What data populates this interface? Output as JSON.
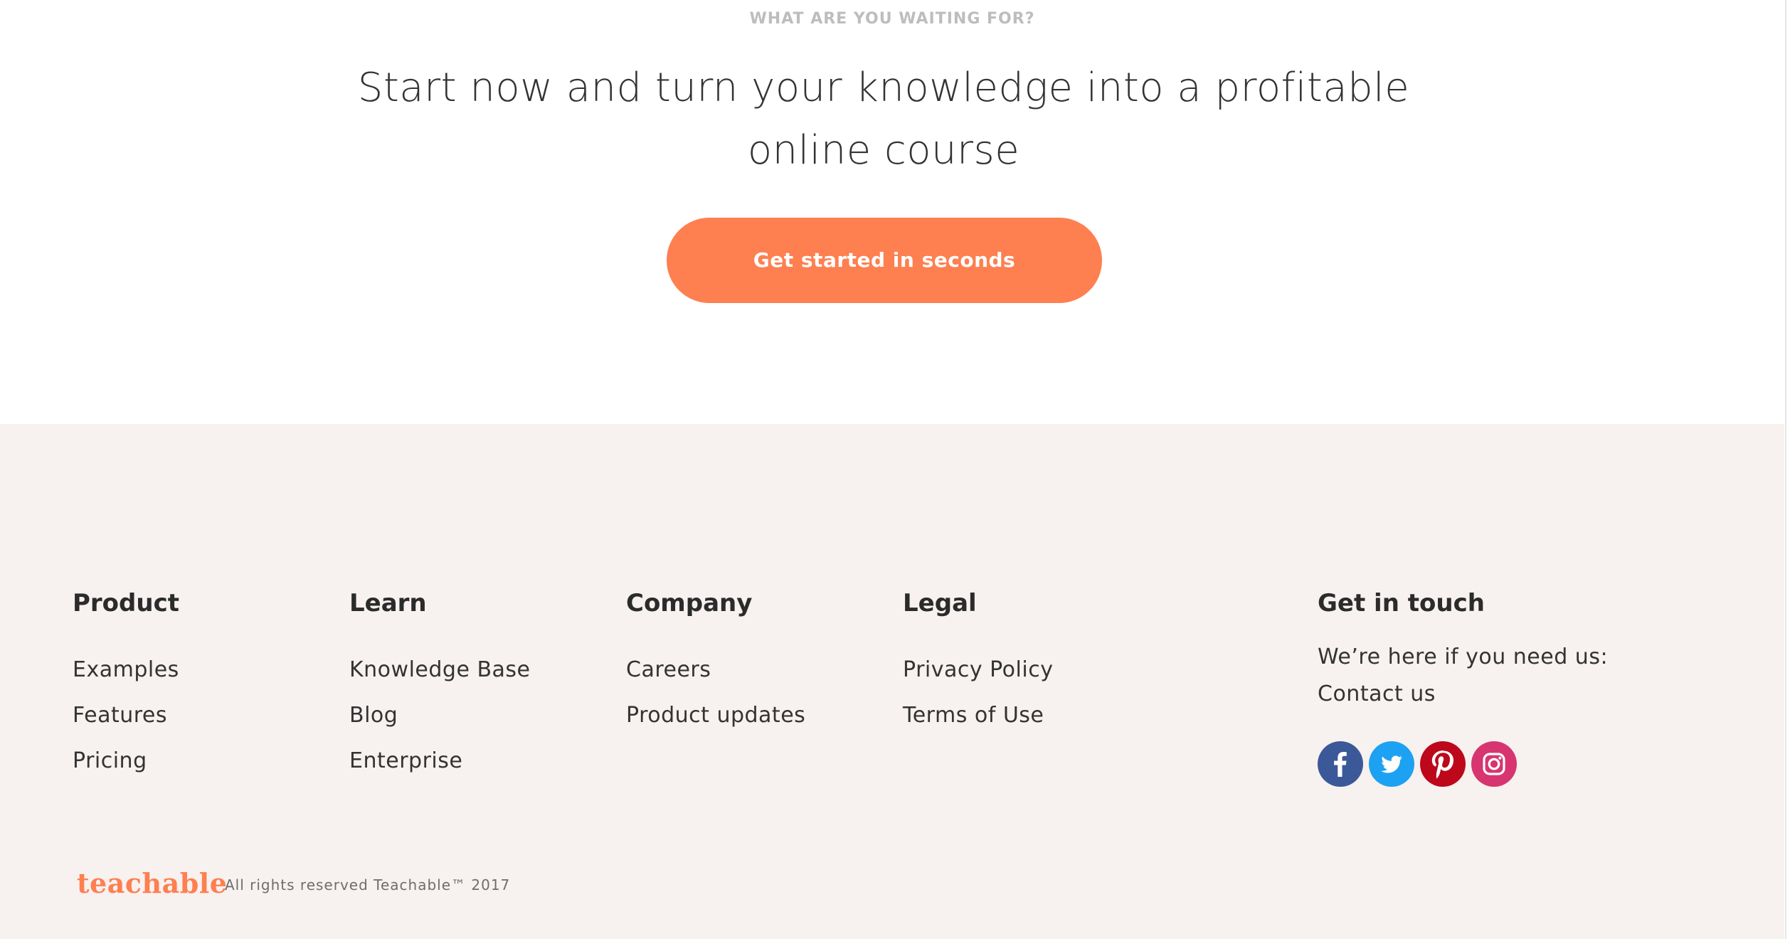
{
  "cta": {
    "eyebrow": "WHAT ARE YOU WAITING FOR?",
    "title_line1": "Start now and turn your knowledge into a profitable",
    "title_line2": "online course",
    "button_label": "Get started in seconds",
    "accent_color": "#fe7f50"
  },
  "footer": {
    "background_color": "#f7f1ef",
    "columns": [
      {
        "heading": "Product",
        "links": [
          "Examples",
          "Features",
          "Pricing"
        ]
      },
      {
        "heading": "Learn",
        "links": [
          "Knowledge Base",
          "Blog",
          "Enterprise"
        ]
      },
      {
        "heading": "Company",
        "links": [
          "Careers",
          "Product updates"
        ]
      },
      {
        "heading": "Legal",
        "links": [
          "Privacy Policy",
          "Terms of Use"
        ]
      }
    ],
    "get_in_touch": {
      "heading": "Get in touch",
      "text": "We’re here if you need us:",
      "contact_label": "Contact us"
    },
    "socials": [
      {
        "icon": "facebook-icon",
        "color": "#3b5998"
      },
      {
        "icon": "twitter-icon",
        "color": "#1da1f2"
      },
      {
        "icon": "pinterest-icon",
        "color": "#bd081c"
      },
      {
        "icon": "instagram-icon",
        "color": "#d7356f"
      }
    ],
    "brand": "teachable",
    "copyright": "All rights reserved Teachable™ 2017"
  }
}
